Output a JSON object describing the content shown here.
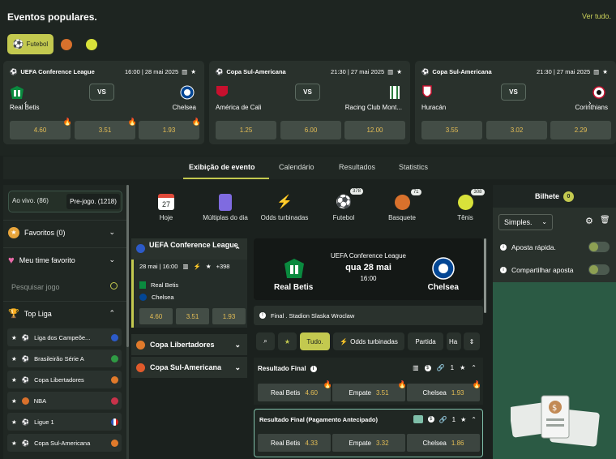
{
  "popular": {
    "title": "Eventos populares.",
    "see_all": "Ver tudo.",
    "chip_futebol": "Futebol",
    "cards": [
      {
        "league": "UEFA Conference League",
        "datetime": "16:00 | 28 mai 2025",
        "vs": "VS",
        "team_a": "Real Betis",
        "team_b": "Chelsea",
        "odds": [
          "4.60",
          "3.51",
          "1.93"
        ]
      },
      {
        "league": "Copa Sul-Americana",
        "datetime": "21:30 | 27 mai 2025",
        "vs": "VS",
        "team_a": "América de Cali",
        "team_b": "Racing Club Mont...",
        "odds": [
          "1.25",
          "6.00",
          "12.00"
        ]
      },
      {
        "league": "Copa Sul-Americana",
        "datetime": "21:30 | 27 mai 2025",
        "vs": "VS",
        "team_a": "Huracán",
        "team_b": "Corinthians",
        "odds": [
          "3.55",
          "3.02",
          "2.29"
        ]
      }
    ]
  },
  "tabs": [
    "Exibição de evento",
    "Calendário",
    "Resultados",
    "Statistics"
  ],
  "left": {
    "ao_vivo": "Ao vivo. (86)",
    "pre_jogo": "Pre-jogo. (1218)",
    "favoritos": "Favoritos (0)",
    "meu_time": "Meu time favorito",
    "search_placeholder": "Pesquisar jogo",
    "top_liga": "Top Liga",
    "leagues": [
      "Liga dos Campeõe...",
      "Brasileirão Série A",
      "Copa Libertadores",
      "NBA",
      "Ligue 1",
      "Copa Sul-Americana"
    ]
  },
  "quick": [
    {
      "label": "Hoje",
      "day": "27"
    },
    {
      "label": "Múltiplas do dia"
    },
    {
      "label": "Odds turbinadas"
    },
    {
      "label": "Futebol",
      "badge": "378"
    },
    {
      "label": "Basquete",
      "badge": "71"
    },
    {
      "label": "Tênis",
      "badge": "308"
    }
  ],
  "events": {
    "league": "UEFA Conference League",
    "meta": "28 mai | 16:00",
    "more": "+398",
    "team_a": "Real Betis",
    "team_b": "Chelsea",
    "odds": [
      "4.60",
      "3.51",
      "1.93"
    ],
    "comp1": "Copa Libertadores",
    "comp2": "Copa Sul-Americana"
  },
  "match": {
    "league": "UEFA Conference League",
    "day": "qua 28 mai",
    "time": "16:00",
    "team_a": "Real Betis",
    "team_b": "Chelsea",
    "info": "Final . Stadion Slaska Wroclaw"
  },
  "filters": {
    "tudo": "Tudo.",
    "odds": "Odds turbinadas",
    "partida": "Partida",
    "ha": "Ha"
  },
  "markets": [
    {
      "title": "Resultado Final",
      "count": "1",
      "odds": [
        {
          "l": "Real Betis",
          "v": "4.60"
        },
        {
          "l": "Empate",
          "v": "3.51"
        },
        {
          "l": "Chelsea",
          "v": "1.93"
        }
      ]
    },
    {
      "title": "Resultado Final (Pagamento Antecipado)",
      "count": "1",
      "odds": [
        {
          "l": "Real Betis",
          "v": "4.33"
        },
        {
          "l": "Empate",
          "v": "3.32"
        },
        {
          "l": "Chelsea",
          "v": "1.86"
        }
      ]
    }
  ],
  "bilhete": {
    "title": "Bilhete",
    "count": "0",
    "select": "Simples.",
    "opt1": "Aposta rápida.",
    "opt2": "Compartilhar aposta"
  },
  "colors": {
    "accent": "#c3c94f",
    "odds": "#e5be55",
    "bg": "#1b211e"
  }
}
